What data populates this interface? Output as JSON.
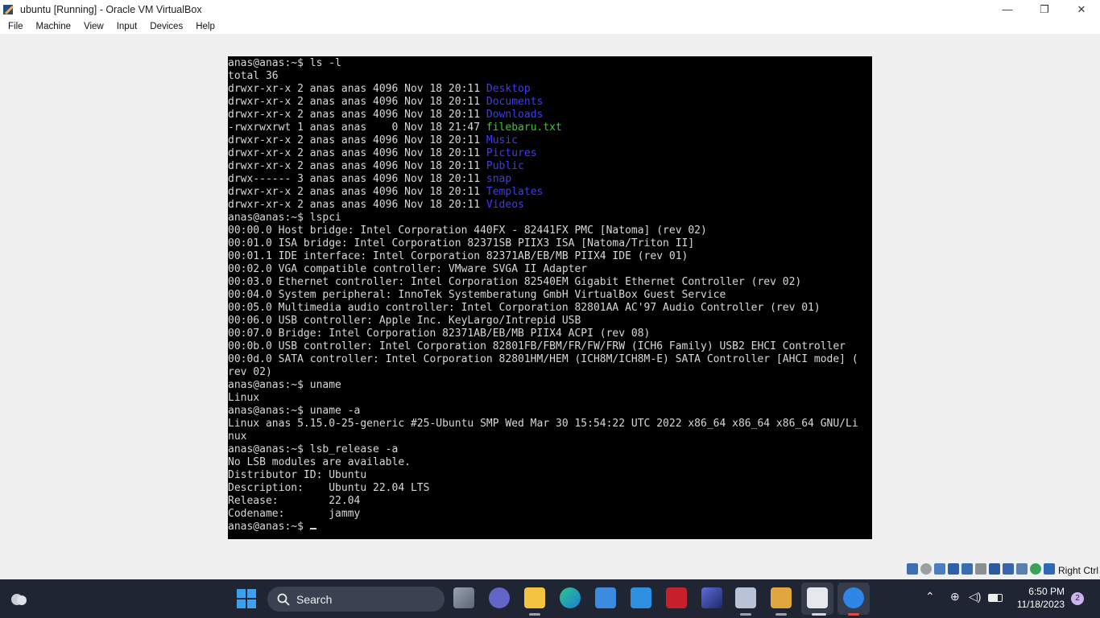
{
  "window": {
    "title": "ubuntu [Running] - Oracle VM VirtualBox"
  },
  "window_controls": {
    "minimize": "—",
    "restore": "❐",
    "close": "✕"
  },
  "menu": [
    "File",
    "Machine",
    "View",
    "Input",
    "Devices",
    "Help"
  ],
  "terminal": {
    "lines": [
      {
        "t": "anas@anas:~$ ls -l"
      },
      {
        "t": "total 36"
      },
      {
        "t": "drwxr-xr-x 2 anas anas 4096 Nov 18 20:11 ",
        "n": "Desktop",
        "c": "blue"
      },
      {
        "t": "drwxr-xr-x 2 anas anas 4096 Nov 18 20:11 ",
        "n": "Documents",
        "c": "blue"
      },
      {
        "t": "drwxr-xr-x 2 anas anas 4096 Nov 18 20:11 ",
        "n": "Downloads",
        "c": "blue"
      },
      {
        "t": "-rwxrwxrwt 1 anas anas    0 Nov 18 21:47 ",
        "n": "filebaru.txt",
        "c": "green"
      },
      {
        "t": "drwxr-xr-x 2 anas anas 4096 Nov 18 20:11 ",
        "n": "Music",
        "c": "blue"
      },
      {
        "t": "drwxr-xr-x 2 anas anas 4096 Nov 18 20:11 ",
        "n": "Pictures",
        "c": "blue"
      },
      {
        "t": "drwxr-xr-x 2 anas anas 4096 Nov 18 20:11 ",
        "n": "Public",
        "c": "blue"
      },
      {
        "t": "drwx------ 3 anas anas 4096 Nov 18 20:11 ",
        "n": "snap",
        "c": "blue"
      },
      {
        "t": "drwxr-xr-x 2 anas anas 4096 Nov 18 20:11 ",
        "n": "Templates",
        "c": "blue"
      },
      {
        "t": "drwxr-xr-x 2 anas anas 4096 Nov 18 20:11 ",
        "n": "Videos",
        "c": "blue"
      },
      {
        "t": "anas@anas:~$ lspci"
      },
      {
        "t": "00:00.0 Host bridge: Intel Corporation 440FX - 82441FX PMC [Natoma] (rev 02)"
      },
      {
        "t": "00:01.0 ISA bridge: Intel Corporation 82371SB PIIX3 ISA [Natoma/Triton II]"
      },
      {
        "t": "00:01.1 IDE interface: Intel Corporation 82371AB/EB/MB PIIX4 IDE (rev 01)"
      },
      {
        "t": "00:02.0 VGA compatible controller: VMware SVGA II Adapter"
      },
      {
        "t": "00:03.0 Ethernet controller: Intel Corporation 82540EM Gigabit Ethernet Controller (rev 02)"
      },
      {
        "t": "00:04.0 System peripheral: InnoTek Systemberatung GmbH VirtualBox Guest Service"
      },
      {
        "t": "00:05.0 Multimedia audio controller: Intel Corporation 82801AA AC'97 Audio Controller (rev 01)"
      },
      {
        "t": "00:06.0 USB controller: Apple Inc. KeyLargo/Intrepid USB"
      },
      {
        "t": "00:07.0 Bridge: Intel Corporation 82371AB/EB/MB PIIX4 ACPI (rev 08)"
      },
      {
        "t": "00:0b.0 USB controller: Intel Corporation 82801FB/FBM/FR/FW/FRW (ICH6 Family) USB2 EHCI Controller"
      },
      {
        "t": "00:0d.0 SATA controller: Intel Corporation 82801HM/HEM (ICH8M/ICH8M-E) SATA Controller [AHCI mode] ("
      },
      {
        "t": "rev 02)"
      },
      {
        "t": "anas@anas:~$ uname"
      },
      {
        "t": "Linux"
      },
      {
        "t": "anas@anas:~$ uname -a"
      },
      {
        "t": "Linux anas 5.15.0-25-generic #25-Ubuntu SMP Wed Mar 30 15:54:22 UTC 2022 x86_64 x86_64 x86_64 GNU/Li"
      },
      {
        "t": "nux"
      },
      {
        "t": "anas@anas:~$ lsb_release -a"
      },
      {
        "t": "No LSB modules are available."
      },
      {
        "t": "Distributor ID: Ubuntu"
      },
      {
        "t": "Description:    Ubuntu 22.04 LTS"
      },
      {
        "t": "Release:        22.04"
      },
      {
        "t": "Codename:       jammy"
      },
      {
        "t": "anas@anas:~$ ",
        "cursor": true
      }
    ]
  },
  "statusbar": {
    "host_key": "Right Ctrl"
  },
  "taskbar": {
    "search_label": "Search",
    "clock_time": "6:50 PM",
    "clock_date": "11/18/2023",
    "notification_count": "2"
  }
}
